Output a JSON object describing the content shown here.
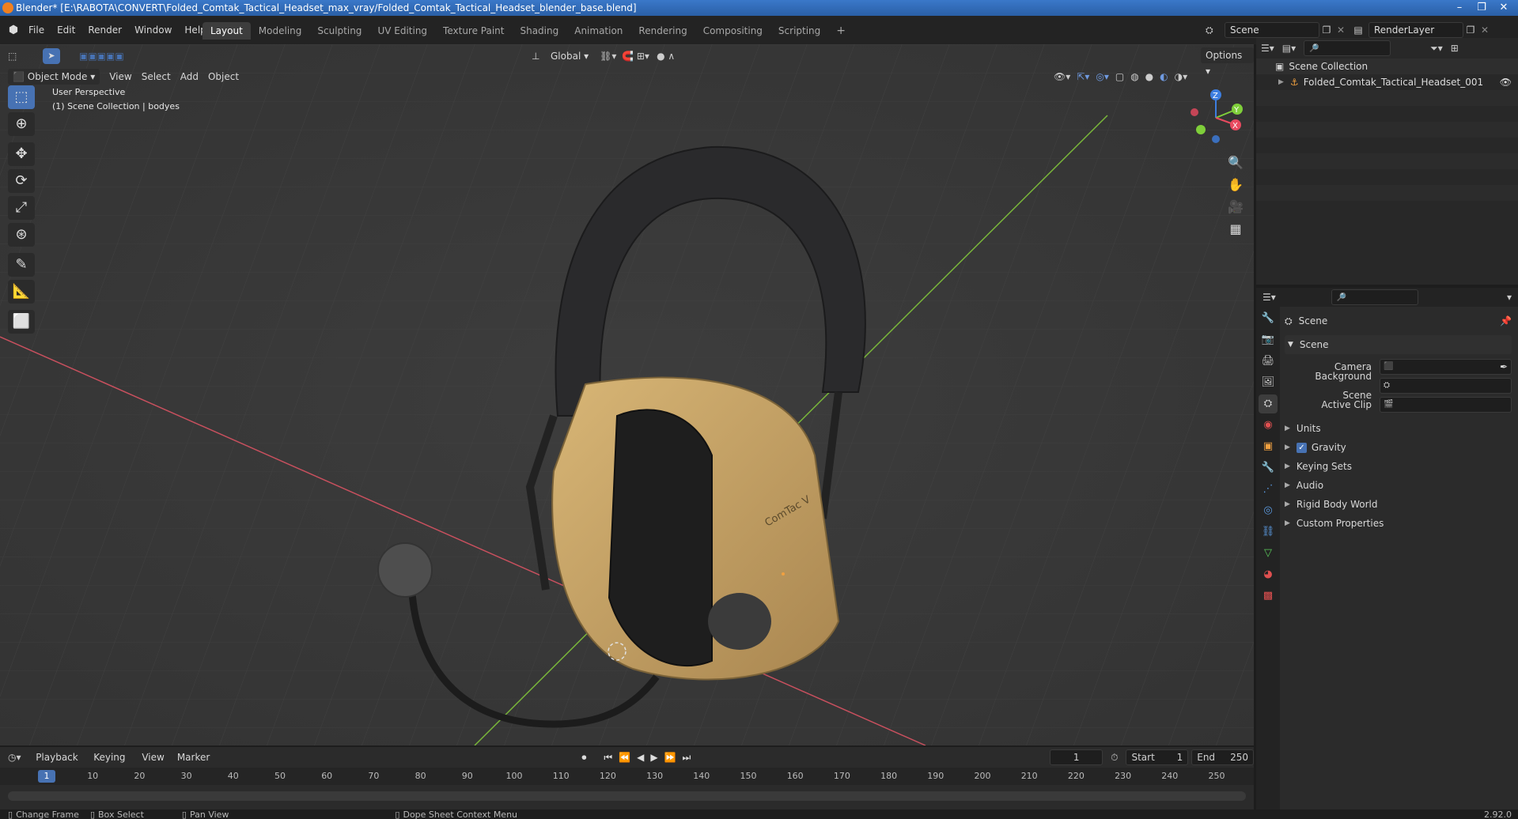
{
  "window": {
    "title": "Blender* [E:\\RABOTA\\CONVERT\\Folded_Comtak_Tactical_Headset_max_vray/Folded_Comtak_Tactical_Headset_blender_base.blend]"
  },
  "menu": [
    "File",
    "Edit",
    "Render",
    "Window",
    "Help"
  ],
  "workspaces": [
    "Layout",
    "Modeling",
    "Sculpting",
    "UV Editing",
    "Texture Paint",
    "Shading",
    "Animation",
    "Rendering",
    "Compositing",
    "Scripting"
  ],
  "active_workspace": "Layout",
  "scene_selector": {
    "label": "Scene"
  },
  "render_layer": {
    "label": "RenderLayer"
  },
  "viewport_header": {
    "mode": "Object Mode",
    "menus": [
      "View",
      "Select",
      "Add",
      "Object"
    ],
    "transform_orientation": "Global",
    "options_label": "Options"
  },
  "viewport": {
    "perspective": "User Perspective",
    "collection_info": "(1) Scene Collection | bodyes",
    "model_label": "ComTac V",
    "gizmo_axes": {
      "x": "X",
      "y": "Y",
      "z": "Z"
    }
  },
  "outliner": {
    "root": "Scene Collection",
    "items": [
      {
        "name": "Folded_Comtak_Tactical_Headset_001"
      }
    ]
  },
  "properties": {
    "context": "Scene",
    "section": "Scene",
    "fields": [
      {
        "label": "Camera",
        "value": ""
      },
      {
        "label": "Background Scene",
        "value": ""
      },
      {
        "label": "Active Clip",
        "value": ""
      }
    ],
    "subpanels": [
      {
        "label": "Units"
      },
      {
        "label": "Gravity",
        "checked": true
      },
      {
        "label": "Keying Sets"
      },
      {
        "label": "Audio"
      },
      {
        "label": "Rigid Body World"
      },
      {
        "label": "Custom Properties"
      }
    ]
  },
  "timeline": {
    "menus": [
      "Playback",
      "Keying",
      "View",
      "Marker"
    ],
    "current_frame": "1",
    "start_label": "Start",
    "start": "1",
    "end_label": "End",
    "end": "250",
    "ruler": [
      "1",
      "10",
      "20",
      "30",
      "40",
      "50",
      "60",
      "70",
      "80",
      "90",
      "100",
      "110",
      "120",
      "130",
      "140",
      "150",
      "160",
      "170",
      "180",
      "190",
      "200",
      "210",
      "220",
      "230",
      "240",
      "250"
    ]
  },
  "statusbar": {
    "items": [
      "Change Frame",
      "Box Select",
      "Pan View",
      "Dope Sheet Context Menu"
    ],
    "version": "2.92.0"
  },
  "colors": {
    "accent": "#4772b3",
    "headset_body": "#c9a566",
    "x_axis": "#e84a5f",
    "y_axis": "#7fcf3a",
    "z_axis": "#3d7ee0"
  }
}
